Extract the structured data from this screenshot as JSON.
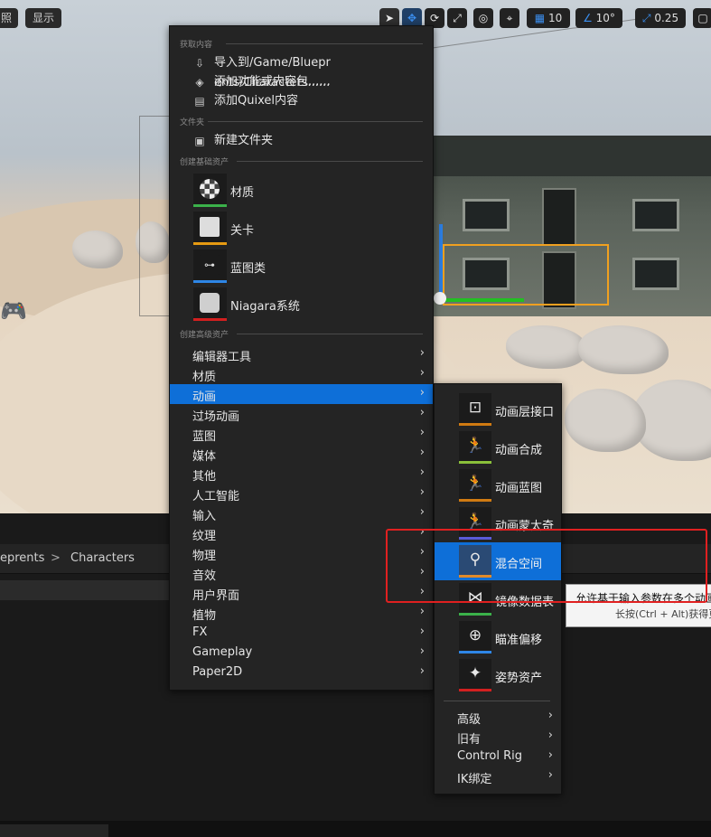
{
  "viewport": {
    "left_buttons": [
      "照",
      "显示"
    ],
    "toolbar": {
      "grid_snap": "10",
      "rot_snap": "10°",
      "scale_snap": "0.25"
    }
  },
  "content_browser": {
    "breadcrumb": [
      "eprents",
      "Characters"
    ],
    "separator": ">"
  },
  "context_menu": {
    "section_get_content": "获取内容",
    "import_label": "导入到/Game/Bluepr​ents/Characters......",
    "add_feature_label": "添加功能或内容包......",
    "add_quixel_label": "添加Quixel内容",
    "section_folder": "文件夹",
    "new_folder_label": "新建文件夹",
    "section_basic": "创建基础资产",
    "basic_assets": [
      {
        "label": "材质",
        "color": "#3bb14a"
      },
      {
        "label": "关卡",
        "color": "#e69a12"
      },
      {
        "label": "蓝图类",
        "color": "#2e86e6"
      },
      {
        "label": "Niagara系统",
        "color": "#d32020"
      }
    ],
    "section_advanced": "创建高级资产",
    "advanced_items": [
      "编辑器工具",
      "材质",
      "动画",
      "过场动画",
      "蓝图",
      "媒体",
      "其他",
      "人工智能",
      "输入",
      "纹理",
      "物理",
      "音效",
      "用户界面",
      "植物",
      "FX",
      "Gameplay",
      "Paper2D"
    ],
    "highlighted_item": "动画",
    "arrow": "›"
  },
  "animation_submenu": {
    "items": [
      {
        "label": "动画层接口",
        "color": "#d07a12",
        "glyph": "⊡"
      },
      {
        "label": "动画合成",
        "color": "#8ac03a",
        "glyph": "🏃"
      },
      {
        "label": "动画蓝图",
        "color": "#d07a12",
        "glyph": "🏃"
      },
      {
        "label": "动画蒙太奇",
        "color": "#5a5ad8",
        "glyph": "🏃"
      },
      {
        "label": "混合空间",
        "color": "#e08a2a",
        "glyph": "⚲"
      },
      {
        "label": "镜像数据表",
        "color": "#3bb14a",
        "glyph": "⋈"
      },
      {
        "label": "瞄准偏移",
        "color": "#2e86e6",
        "glyph": "⊕"
      },
      {
        "label": "姿势资产",
        "color": "#d32020",
        "glyph": "✦"
      }
    ],
    "highlighted_item": "混合空间",
    "more": [
      "高级",
      "旧有",
      "Control Rig",
      "IK绑定"
    ],
    "arrow": "›"
  },
  "tooltip": {
    "line1": "允许基于输入参数在多个动画",
    "line2": "长按(Ctrl + Alt)获得更"
  }
}
